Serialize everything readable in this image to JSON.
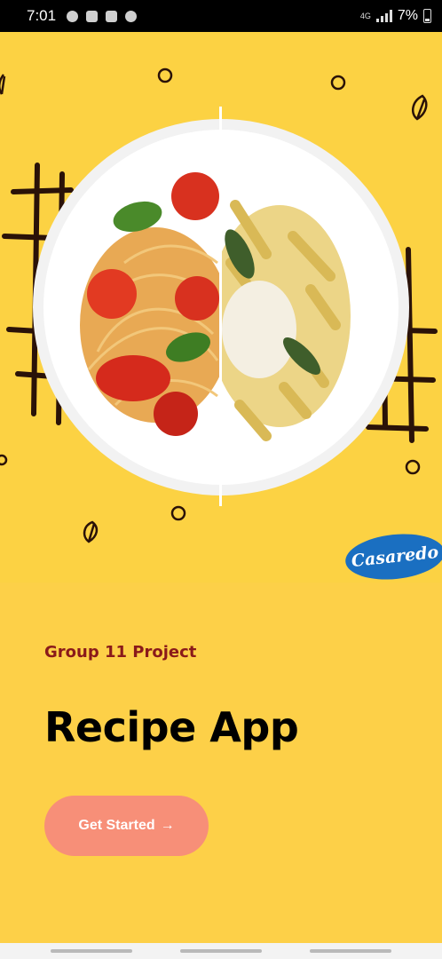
{
  "status_bar": {
    "time": "7:01",
    "network": "4G",
    "battery": "7%"
  },
  "hero": {
    "brand": "Casaredo"
  },
  "content": {
    "subtitle": "Group 11 Project",
    "title": "Recipe App",
    "cta_label": "Get Started",
    "cta_icon": "→"
  },
  "colors": {
    "background": "#fdd048",
    "subtitle": "#8a1a1a",
    "button": "#f78f78",
    "brand_badge": "#1a6fc1"
  }
}
